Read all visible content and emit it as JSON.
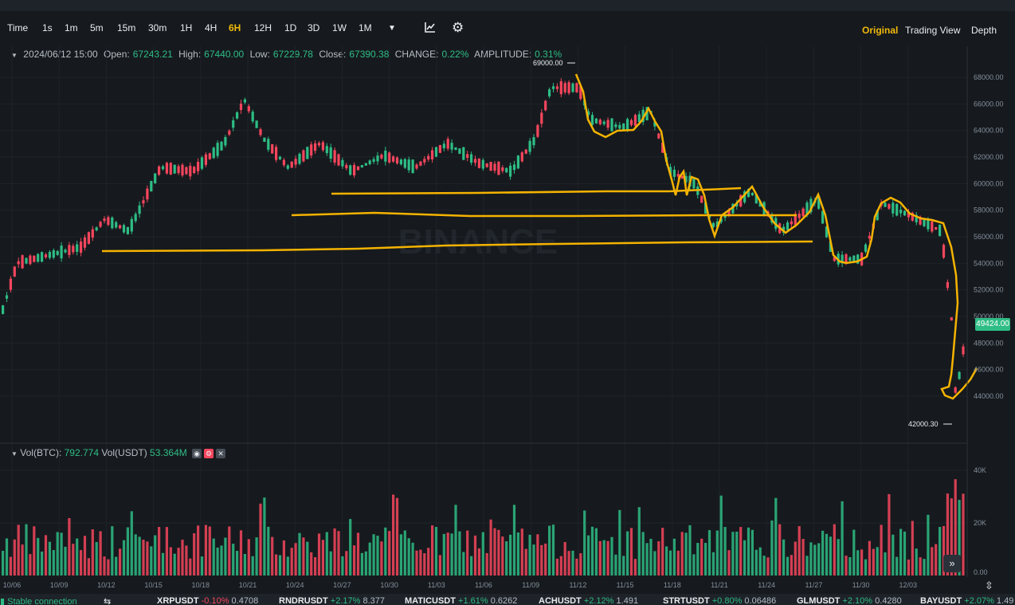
{
  "toolbar": {
    "intervals": [
      "Time",
      "1s",
      "1m",
      "5m",
      "15m",
      "30m",
      "1H",
      "4H",
      "6H",
      "12H",
      "1D",
      "3D",
      "1W",
      "1M"
    ],
    "active_interval": "6H",
    "views": [
      "Original",
      "Trading View",
      "Depth"
    ],
    "active_view": "Original"
  },
  "ohlc": {
    "date": "2024/06/12 15:00",
    "open_label": "Open:",
    "open": "67243.21",
    "high_label": "High:",
    "high": "67440.00",
    "low_label": "Low:",
    "low": "67229.78",
    "close_label": "Close:",
    "close": "67390.38",
    "change_label": "CHANGE:",
    "change": "0.22%",
    "amp_label": "AMPLITUDE:",
    "amp": "0.31%"
  },
  "volume": {
    "btc_label": "Vol(BTC):",
    "btc": "792.774",
    "usdt_label": "Vol(USDT)",
    "usdt": "53.364M"
  },
  "price_tag": "49424.00",
  "annotations": {
    "high_marker": "69000.00",
    "low_marker": "42000.30"
  },
  "watermark": "BINANCE",
  "price_axis": [
    "68000.00",
    "66000.00",
    "64000.00",
    "62000.00",
    "60000.00",
    "58000.00",
    "56000.00",
    "54000.00",
    "52000.00",
    "50000.00",
    "48000.00",
    "46000.00",
    "44000.00"
  ],
  "volume_axis": [
    "40K",
    "20K",
    "0.00"
  ],
  "date_axis": [
    "10/06",
    "10/09",
    "10/12",
    "10/15",
    "10/18",
    "10/21",
    "10/24",
    "10/27",
    "10/30",
    "11/03",
    "11/06",
    "11/09",
    "11/12",
    "11/15",
    "11/18",
    "11/21",
    "11/24",
    "11/27",
    "11/30",
    "12/03"
  ],
  "status": {
    "connection": "Stable connection",
    "tickers": [
      {
        "sym": "XRPUSDT",
        "chg": "-0.10%",
        "price": "0.4708",
        "color": "#f6465d"
      },
      {
        "sym": "RNDRUSDT",
        "chg": "+2.17%",
        "price": "8.377",
        "color": "#2ebd85"
      },
      {
        "sym": "MATICUSDT",
        "chg": "+1.61%",
        "price": "0.6262",
        "color": "#2ebd85"
      },
      {
        "sym": "ACHUSDT",
        "chg": "+2.12%",
        "price": "1.491",
        "color": "#2ebd85"
      },
      {
        "sym": "STRTUSDT",
        "chg": "+0.80%",
        "price": "0.06486",
        "color": "#2ebd85"
      },
      {
        "sym": "GLMUSDT",
        "chg": "+2.10%",
        "price": "0.4280",
        "color": "#2ebd85"
      },
      {
        "sym": "BAYUSDT",
        "chg": "+2.07%",
        "price": "1.49",
        "color": "#2ebd85"
      }
    ]
  },
  "colors": {
    "up": "#2ebd85",
    "down": "#f6465d",
    "accent": "#f0b90b",
    "drawing": "#f5b300"
  }
}
